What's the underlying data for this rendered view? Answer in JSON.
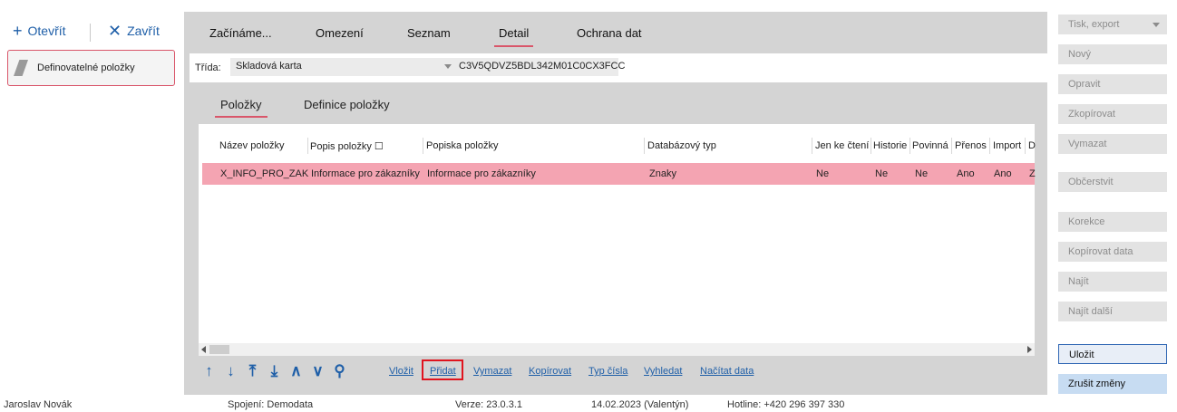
{
  "toolbar": {
    "open_label": "Otevřít",
    "close_label": "Zavřít"
  },
  "sidebar": {
    "item_label": "Definovatelné položky"
  },
  "tabs": [
    "Začínáme...",
    "Omezení",
    "Seznam",
    "Detail",
    "Ochrana dat"
  ],
  "trida": {
    "label": "Třída:",
    "value": "Skladová karta",
    "code": "C3V5QDVZ5BDL342M01C0CX3FCC"
  },
  "subtabs": [
    "Položky",
    "Definice položky"
  ],
  "grid": {
    "columns": [
      "Název položky",
      "Popis položky ☐",
      "Popiska položky",
      "Databázový typ",
      "Jen ke čtení",
      "Historie",
      "Povinná",
      "Přenos",
      "Import",
      "D"
    ],
    "rows": [
      [
        "X_INFO_PRO_ZAK",
        "Informace pro zákazníky",
        "Informace pro zákazníky",
        "Znaky",
        "Ne",
        "Ne",
        "Ne",
        "Ano",
        "Ano",
        "Z"
      ]
    ]
  },
  "nav_icons": [
    "arrow-up-icon",
    "arrow-down-icon",
    "arrow-to-top-icon",
    "arrow-to-bottom-icon",
    "chevron-up-icon",
    "chevron-down-icon",
    "search-icon"
  ],
  "actions": [
    "Vložit",
    "Přidat",
    "Vymazat",
    "Kopírovat",
    "Typ čísla",
    "Vyhledat",
    "Načítat data"
  ],
  "right_panel": {
    "print": "Tisk, export",
    "new": "Nový",
    "edit": "Opravit",
    "copy": "Zkopírovat",
    "delete": "Vymazat",
    "refresh": "Občerstvit",
    "correction": "Korekce",
    "copy_data": "Kopírovat data",
    "find": "Najít",
    "find_next": "Najít další",
    "save": "Uložit",
    "cancel": "Zrušit změny"
  },
  "status": {
    "user": "Jaroslav Novák",
    "connection": "Spojení: Demodata",
    "version": "Verze: 23.0.3.1",
    "date": "14.02.2023 (Valentýn)",
    "hotline": "Hotline: +420 296 397 330"
  },
  "colors": {
    "accent": "#d9566a",
    "selected_row": "#f4a4b2",
    "link": "#1f5fa8",
    "highlight_box": "#e0141e"
  }
}
